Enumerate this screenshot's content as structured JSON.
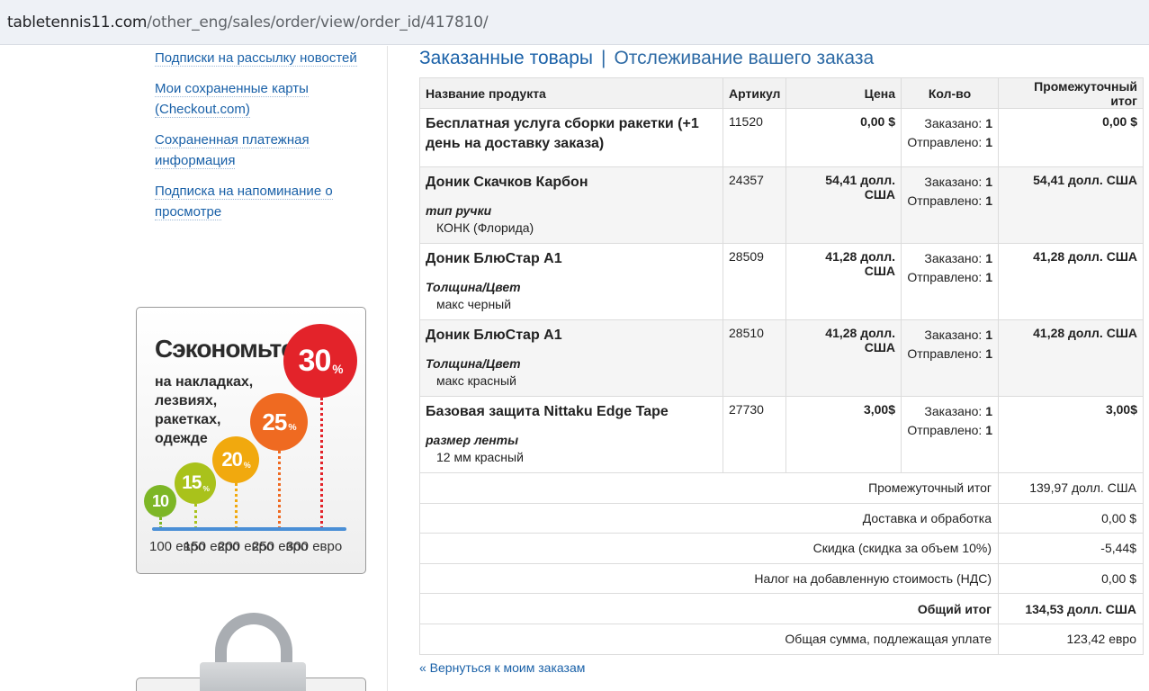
{
  "browser": {
    "url_host": "tabletennis11.com",
    "url_path": "/other_eng/sales/order/view/order_id/417810/"
  },
  "sidebar": {
    "links": [
      "Подписки на рассылку новостей",
      "Мои сохраненные карты (Checkout.com)",
      "Сохраненная платежная информация",
      "Подписка на напоминание о просмотре"
    ],
    "promo": {
      "title": "Сэкономьте до",
      "subtitle": "на накладках, лезвиях, ракетках, одежде",
      "percent_sign": "%",
      "bubbles": [
        "30",
        "25",
        "20",
        "15",
        "10"
      ],
      "thresholds": [
        "100 евро",
        "150 евро",
        "200 евро",
        "250 евро",
        "300 евро"
      ]
    }
  },
  "main": {
    "tabs": [
      "Заказанные товары",
      "Отслеживание вашего заказа"
    ],
    "tab_separator": "|",
    "columns": [
      "Название продукта",
      "Артикул",
      "Цена",
      "Кол-во",
      "Промежуточный итог"
    ],
    "qty_labels": {
      "ordered": "Заказано:",
      "shipped": "Отправлено:"
    },
    "items": [
      {
        "name": "Бесплатная услуга сборки ракетки (+1 день на доставку заказа)",
        "option_label": "",
        "option_value": "",
        "sku": "11520",
        "price": "0,00 $",
        "ordered": "1",
        "shipped": "1",
        "subtotal": "0,00 $"
      },
      {
        "name": "Доник Скачков Карбон",
        "option_label": "тип ручки",
        "option_value": "КОНК (Флорида)",
        "sku": "24357",
        "price": "54,41 долл. США",
        "ordered": "1",
        "shipped": "1",
        "subtotal": "54,41 долл. США"
      },
      {
        "name": "Доник БлюСтар А1",
        "option_label": "Толщина/Цвет",
        "option_value": "макс черный",
        "sku": "28509",
        "price": "41,28 долл. США",
        "ordered": "1",
        "shipped": "1",
        "subtotal": "41,28 долл. США"
      },
      {
        "name": "Доник БлюСтар А1",
        "option_label": "Толщина/Цвет",
        "option_value": "макс красный",
        "sku": "28510",
        "price": "41,28 долл. США",
        "ordered": "1",
        "shipped": "1",
        "subtotal": "41,28 долл. США"
      },
      {
        "name": "Базовая защита Nittaku Edge Tape",
        "option_label": "размер ленты",
        "option_value": "12 мм красный",
        "sku": "27730",
        "price": "3,00$",
        "ordered": "1",
        "shipped": "1",
        "subtotal": "3,00$"
      }
    ],
    "totals": [
      {
        "label": "Промежуточный итог",
        "value": "139,97 долл. США",
        "bold": false
      },
      {
        "label": "Доставка и обработка",
        "value": "0,00 $",
        "bold": false
      },
      {
        "label": "Скидка (скидка за объем 10%)",
        "value": "-5,44$",
        "bold": false
      },
      {
        "label": "Налог на добавленную стоимость (НДС)",
        "value": "0,00 $",
        "bold": false
      },
      {
        "label": "Общий итог",
        "value": "134,53 долл. США",
        "bold": true
      },
      {
        "label": "Общая сумма, подлежащая уплате",
        "value": "123,42 евро",
        "bold": false
      }
    ],
    "back_link": "« Вернуться к моим заказам"
  },
  "colors": {
    "link": "#1a61a8",
    "bubble_30": "#e3232a",
    "bubble_25": "#ef6a21",
    "bubble_20": "#f1a90e",
    "bubble_15": "#a9c21b",
    "bubble_10": "#7db626",
    "axis": "#4a8fd6"
  }
}
